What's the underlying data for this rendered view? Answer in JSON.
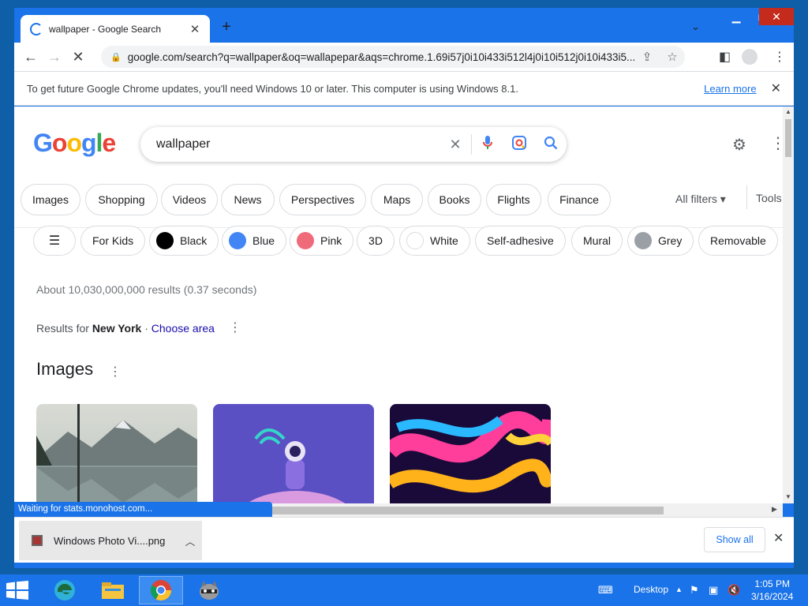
{
  "browser": {
    "tab_title": "wallpaper - Google Search",
    "url": "google.com/search?q=wallpaper&oq=wallapepar&aqs=chrome.1.69i57j0i10i433i512l4j0i10i512j0i10i433i5...",
    "infobar_message": "To get future Google Chrome updates, you'll need Windows 10 or later. This computer is using Windows 8.1.",
    "infobar_link": "Learn more"
  },
  "search": {
    "query": "wallpaper",
    "logo": [
      "G",
      "o",
      "o",
      "g",
      "l",
      "e"
    ]
  },
  "filter_tabs": [
    "Images",
    "Shopping",
    "Videos",
    "News",
    "Perspectives",
    "Maps",
    "Books",
    "Flights",
    "Finance"
  ],
  "all_filters": "All filters",
  "tools": "Tools",
  "refine_chips": [
    {
      "label": "For Kids"
    },
    {
      "label": "Black",
      "color": "#000000"
    },
    {
      "label": "Blue",
      "color": "#4285f4"
    },
    {
      "label": "Pink",
      "color": "#f06b7a"
    },
    {
      "label": "3D"
    },
    {
      "label": "White",
      "color": "#ffffff"
    },
    {
      "label": "Self-adhesive"
    },
    {
      "label": "Mural"
    },
    {
      "label": "Grey",
      "color": "#9aa0a6"
    },
    {
      "label": "Removable"
    }
  ],
  "result_stats": "About 10,030,000,000 results (0.37 seconds)",
  "location": {
    "prefix": "Results for",
    "city": "New York",
    "separator": "·",
    "action": "Choose area"
  },
  "images_heading": "Images",
  "status_text": "Waiting for stats.monohost.com...",
  "download": {
    "filename": "Windows Photo Vi....png",
    "show_all": "Show all"
  },
  "taskbar": {
    "desktop_label": "Desktop",
    "time": "1:05 PM",
    "date": "3/16/2024"
  }
}
